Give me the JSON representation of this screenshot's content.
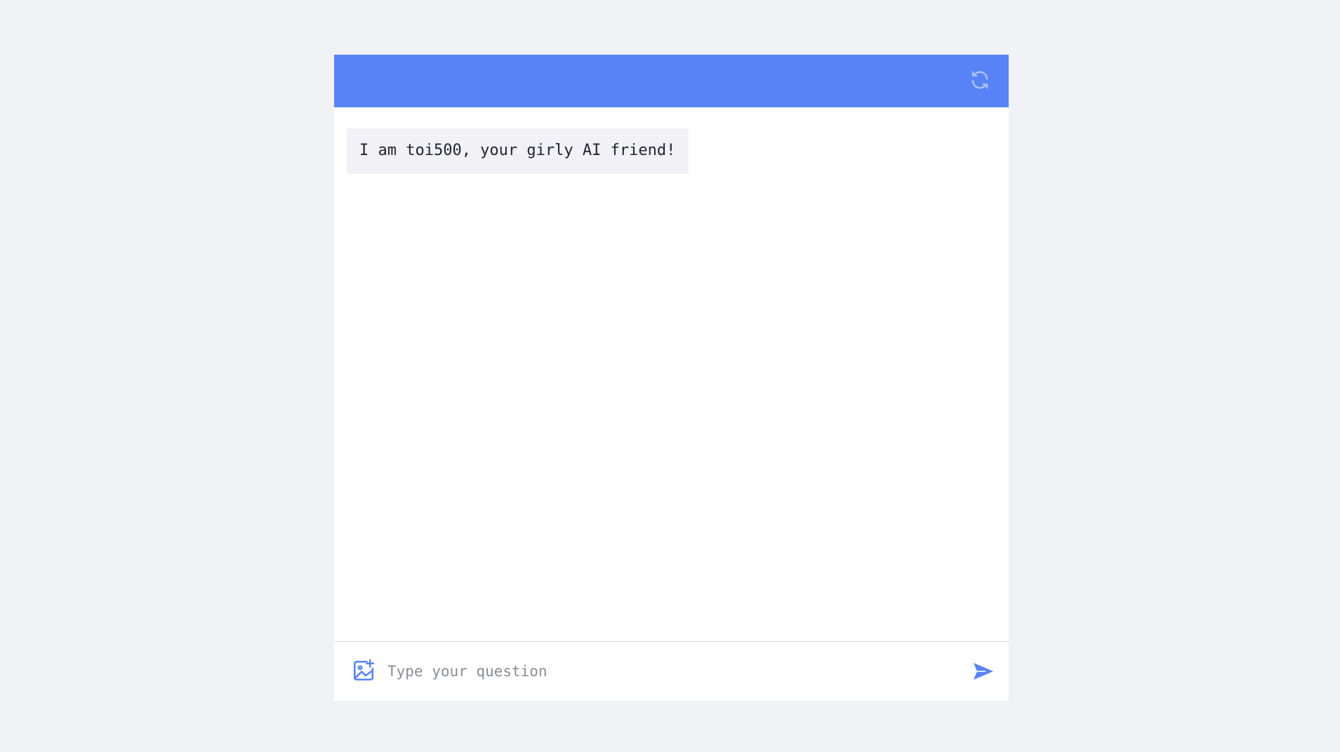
{
  "header": {
    "refresh_icon": "refresh-icon",
    "background_color": "#5783f7"
  },
  "messages": [
    {
      "sender": "bot",
      "text": "I am toi500, your girly AI friend!"
    }
  ],
  "composer": {
    "placeholder": "Type your question",
    "value": "",
    "image_icon": "add-image-icon",
    "send_icon": "send-icon",
    "accent_color": "#5783f7"
  }
}
